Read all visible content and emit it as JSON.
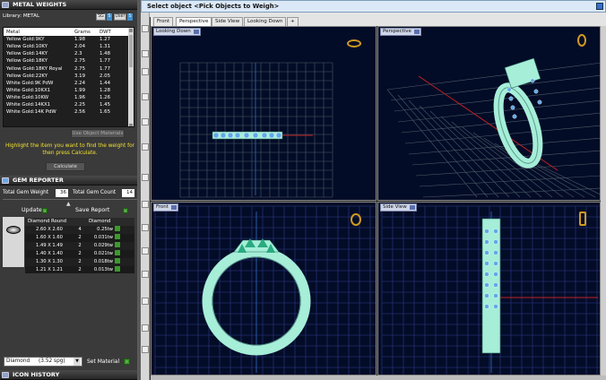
{
  "metal_panel": {
    "title": "METAL WEIGHTS",
    "library_label": "Library: METAL",
    "btn_sg": "SG",
    "btn_s": "S",
    "btn_user": "User",
    "btn_u": "S",
    "columns": [
      "Metal",
      "Grams",
      "DWT"
    ],
    "rows": [
      [
        "Yellow Gold:9KY",
        "1.98",
        "1.27"
      ],
      [
        "Yellow Gold:10KY",
        "2.04",
        "1.31"
      ],
      [
        "Yellow Gold:14KY",
        "2.3",
        "1.48"
      ],
      [
        "Yellow Gold:18KY",
        "2.75",
        "1.77"
      ],
      [
        "Yellow Gold:18KY Royal",
        "2.75",
        "1.77"
      ],
      [
        "Yellow Gold:22KY",
        "3.19",
        "2.05"
      ],
      [
        "White Gold:9K PdW",
        "2.24",
        "1.44"
      ],
      [
        "White Gold:10KX1",
        "1.99",
        "1.28"
      ],
      [
        "White Gold:10KW",
        "1.96",
        "1.26"
      ],
      [
        "White Gold:14KX1",
        "2.25",
        "1.45"
      ],
      [
        "White Gold:14K PdW",
        "2.56",
        "1.65"
      ]
    ],
    "hint": "Highlight the item you want to find the weight for then press Calculate.",
    "use_object_materials": "Use Object Materials",
    "calculate": "Calculate"
  },
  "gem_panel": {
    "title": "GEM REPORTER",
    "total_weight_label": "Total Gem Weight",
    "total_weight_value": "36",
    "total_count_label": "Total Gem Count",
    "total_count_value": "14",
    "update": "Update",
    "save_report": "Save Report",
    "columns": [
      "Diamond Round",
      "",
      "Diamond"
    ],
    "rows": [
      [
        "2.60 X 2.60",
        "4",
        "0.25tw"
      ],
      [
        "1.60 X 1.60",
        "2",
        "0.031tw"
      ],
      [
        "1.49 X 1.49",
        "2",
        "0.029tw"
      ],
      [
        "1.40 X 1.40",
        "2",
        "0.021tw"
      ],
      [
        "1.30 X 1.30",
        "2",
        "0.018tw"
      ],
      [
        "1.21 X 1.21",
        "2",
        "0.013tw"
      ]
    ],
    "diamond_select": "Diamond",
    "diamond_value": "(3.52 spg)",
    "set_material": "Set Material"
  },
  "icon_history": "ICON HISTORY",
  "command_bar": {
    "text": "Select object <Pick Objects to Weigh>"
  },
  "tabs": [
    "Front",
    "Perspective",
    "Side View",
    "Looking Down",
    "+"
  ],
  "viewports": {
    "top_left": "Looking Down",
    "top_right": "Perspective",
    "bottom_left": "Front",
    "bottom_right": "Side View"
  },
  "colors": {
    "metal": "#a6eed8",
    "gem": "#5fa8e8",
    "grid": "#5a6a78",
    "axis_red": "#c02222",
    "axis_green": "#20c020",
    "panel": "#3a3a3a"
  }
}
